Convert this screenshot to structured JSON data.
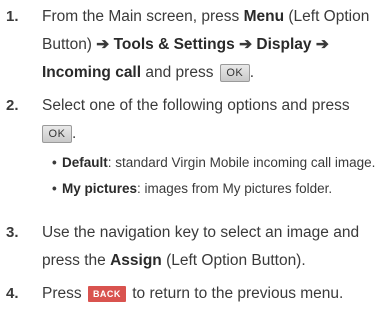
{
  "steps": [
    {
      "num": "1.",
      "t1": "From the Main screen, press",
      "b1": "Menu",
      "t2": "(Left Option Button)",
      "arrow1": "➔",
      "b2": "Tools & Settings",
      "arrow2": "➔",
      "b3": "Display",
      "arrow3": "➔",
      "b4": "Incoming call",
      "t3": "and press",
      "button": "OK",
      "t4": "."
    },
    {
      "num": "2.",
      "t1": "Select one of the following options and press",
      "button": "OK",
      "t2": "."
    },
    {
      "num": "3.",
      "t1": "Use the navigation key to select an image and press the",
      "b1": "Assign",
      "t2": "(Left Option Button)."
    },
    {
      "num": "4.",
      "t1": "Press",
      "button": "BACK",
      "t2": "to return to the previous menu."
    }
  ],
  "options": [
    {
      "bullet": "•",
      "name": "Default",
      "desc": ": standard Virgin Mobile incoming call image."
    },
    {
      "bullet": "•",
      "name": "My pictures",
      "desc": ": images from My pictures folder."
    }
  ]
}
